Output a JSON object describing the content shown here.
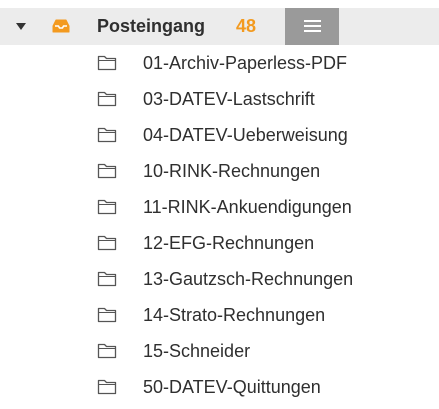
{
  "header": {
    "title": "Posteingang",
    "count": "48",
    "expand_icon": "caret-down-icon",
    "folder_icon": "inbox-icon",
    "menu_icon": "hamburger-menu-icon",
    "count_color": "#f39a1f",
    "icon_color": "#f39a1f"
  },
  "folders": [
    {
      "label": "01-Archiv-Paperless-PDF",
      "icon": "folder-icon"
    },
    {
      "label": "03-DATEV-Lastschrift",
      "icon": "folder-icon"
    },
    {
      "label": "04-DATEV-Ueberweisung",
      "icon": "folder-icon"
    },
    {
      "label": "10-RINK-Rechnungen",
      "icon": "folder-icon"
    },
    {
      "label": "11-RINK-Ankuendigungen",
      "icon": "folder-icon"
    },
    {
      "label": "12-EFG-Rechnungen",
      "icon": "folder-icon"
    },
    {
      "label": "13-Gautzsch-Rechnungen",
      "icon": "folder-icon"
    },
    {
      "label": "14-Strato-Rechnungen",
      "icon": "folder-icon"
    },
    {
      "label": "15-Schneider",
      "icon": "folder-icon"
    },
    {
      "label": "50-DATEV-Quittungen",
      "icon": "folder-icon"
    }
  ]
}
